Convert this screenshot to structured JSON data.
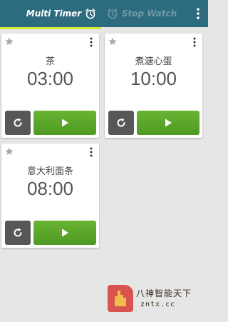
{
  "tabs": {
    "multi_timer": "Multi Timer",
    "stop_watch": "Stop Watch"
  },
  "icons": {
    "multi_timer": "alarm-clock-icon",
    "stop_watch": "alarm-clock-icon",
    "overflow": "vertical-ellipsis-icon",
    "favorite": "star-icon",
    "reset": "refresh-icon",
    "play": "play-icon"
  },
  "timers": [
    {
      "name": "茶",
      "time": "03:00"
    },
    {
      "name": "煮溏心蛋",
      "time": "10:00"
    },
    {
      "name": "意大利面条",
      "time": "08:00"
    }
  ],
  "watermark": {
    "title": "八神智能天下",
    "url": "zntx.cc"
  },
  "colors": {
    "header_bg": "#2d6b7f",
    "tab_indicator": "#d7e83c",
    "page_bg": "#e6e6e6",
    "card_bg": "#ffffff",
    "reset_bg": "#575757",
    "play_bg": "#5aa82b"
  }
}
